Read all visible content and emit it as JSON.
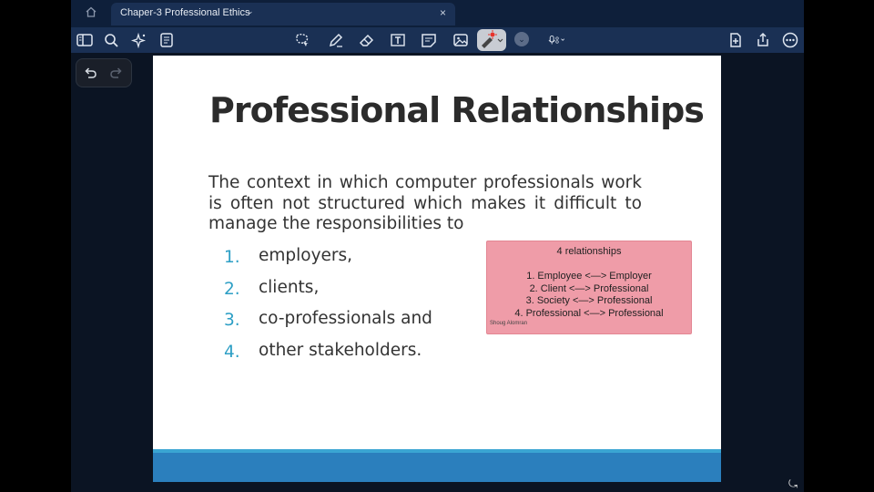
{
  "tab": {
    "title": "Chaper-3 Professional Ethics"
  },
  "toolbar": {
    "left_icons": [
      "sidebar-icon",
      "search-icon",
      "sparkle-icon",
      "notes-icon"
    ],
    "center_icons": [
      "lasso-icon",
      "pencil-icon",
      "eraser-icon",
      "text-box-icon",
      "sticky-note-icon",
      "image-icon",
      "laser-pointer-icon",
      "chevron-down-icon",
      "microphone-icon"
    ],
    "right_icons": [
      "add-page-icon",
      "share-icon",
      "more-icon"
    ]
  },
  "slide": {
    "title": "Professional Relationships",
    "paragraph": "The context in which computer professionals work is often not structured which makes it difficult to manage the responsibilities to",
    "list": [
      {
        "num": "1.",
        "text": "employers,"
      },
      {
        "num": "2.",
        "text": "clients,"
      },
      {
        "num": "3.",
        "text": "co-professionals and"
      },
      {
        "num": "4.",
        "text": "other stakeholders."
      }
    ]
  },
  "note": {
    "title": "4 relationships",
    "lines": [
      "1. Employee <—> Employer",
      "2. Client <—> Professional",
      "3. Society <—> Professional",
      "4. Professional <—> Professional"
    ],
    "author": "Shoug Alomran",
    "color": "#ef9ca8"
  },
  "colors": {
    "accent": "#2b7fbd",
    "list_number": "#2d9fc5",
    "toolbar": "#1a3054"
  }
}
